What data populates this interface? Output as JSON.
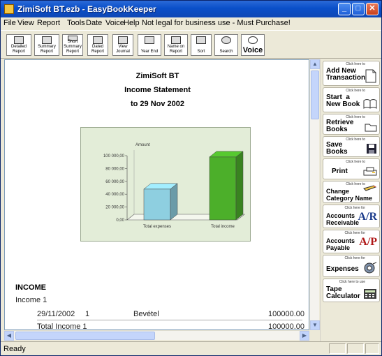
{
  "window": {
    "title": "ZimiSoft BT.ezb - EasyBookKeeper"
  },
  "menu": {
    "items": [
      "File",
      "View",
      "Report",
      "Tools",
      "Date",
      "Voice",
      "Help"
    ],
    "notice": "Not legal for business use - Must Purchase!"
  },
  "toolbar": {
    "buttons": [
      {
        "label1": "Detailed",
        "label2": "Report"
      },
      {
        "label1": "Summary",
        "label2": "Report"
      },
      {
        "label1": "Short Summary",
        "label2": "Report"
      },
      {
        "label1": "Dated",
        "label2": "Report"
      },
      {
        "label1": "View",
        "label2": "Journal"
      },
      {
        "label1": "",
        "label2": "Year End"
      },
      {
        "label1": "Name on",
        "label2": "Report"
      },
      {
        "label1": "",
        "label2": "Sort"
      },
      {
        "label1": "",
        "label2": "Search"
      },
      {
        "label1": "",
        "label2": "Voice"
      }
    ]
  },
  "report": {
    "company": "ZimiSoft BT",
    "title": "Income Statement",
    "date": "to 29 Nov 2002",
    "section": "INCOME",
    "category": "Income 1",
    "rows": [
      {
        "date": "29/11/2002",
        "num": "1",
        "desc": "Bevétel",
        "amount": "100000.00"
      }
    ],
    "total_label": "Total Income 1",
    "total_amount": "100000.00"
  },
  "chart_data": {
    "type": "bar",
    "title": "",
    "ylabel": "Amount",
    "categories": [
      "Total expenses",
      "Total income"
    ],
    "values": [
      48000,
      98000
    ],
    "colors": [
      "#8ecfe0",
      "#4caf2a"
    ],
    "ylim": [
      0,
      100000
    ],
    "yticks": [
      "0,00",
      "20 000,00",
      "40 000,00",
      "60 000,00",
      "80 000,00",
      "100 000,00"
    ]
  },
  "side": {
    "buttons": [
      {
        "small": "Click here to",
        "big": "Add New\nTransactions",
        "icon": "page-icon"
      },
      {
        "small": "Click here to",
        "big": "Start  a\nNew Book",
        "icon": "book-icon"
      },
      {
        "small": "Click here to",
        "big": "Retrieve\nBooks",
        "icon": "folder-icon"
      },
      {
        "small": "Click here to",
        "big": "Save\nBooks",
        "icon": "floppy-icon"
      },
      {
        "small": "Click here to",
        "big": "Print",
        "icon": "printer-icon"
      },
      {
        "small": "Click here to",
        "big": "Change\nCategory Name",
        "icon": "pencil-icon"
      },
      {
        "small": "Click here for",
        "big": "Accounts\nReceivable",
        "icon": "ar-icon",
        "tag": "A/R"
      },
      {
        "small": "Click here for",
        "big": "Accounts\nPayable",
        "icon": "ap-icon",
        "tag": "A/P"
      },
      {
        "small": "Click here for",
        "big": "Expenses",
        "icon": "expenses-icon"
      },
      {
        "small": "Click here to use",
        "big": "Tape\nCalculator",
        "icon": "calculator-icon"
      }
    ]
  },
  "status": {
    "text": "Ready"
  }
}
